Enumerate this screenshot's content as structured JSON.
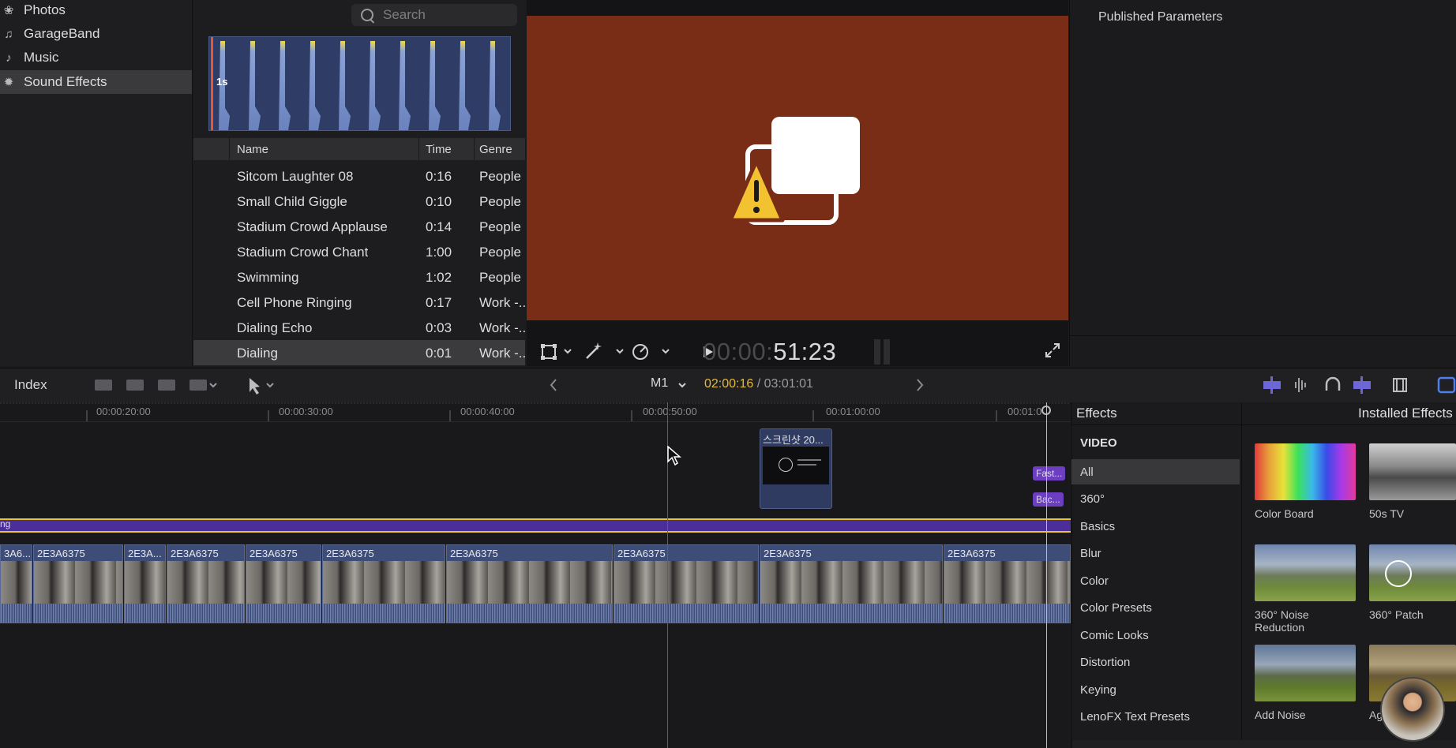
{
  "sidebar": {
    "items": [
      {
        "label": "Photos",
        "icon": "photos-icon"
      },
      {
        "label": "GarageBand",
        "icon": "garageband-icon"
      },
      {
        "label": "Music",
        "icon": "music-icon"
      },
      {
        "label": "Sound Effects",
        "icon": "sound-effects-icon",
        "selected": true
      }
    ]
  },
  "browser": {
    "search_placeholder": "Search",
    "waveform_label": "1s",
    "columns": [
      "Name",
      "Time",
      "Genre"
    ],
    "rows": [
      {
        "name": "Sitcom Laughter 08",
        "time": "0:16",
        "genre": "People"
      },
      {
        "name": "Small Child Giggle",
        "time": "0:10",
        "genre": "People"
      },
      {
        "name": "Stadium Crowd Applause",
        "time": "0:14",
        "genre": "People"
      },
      {
        "name": "Stadium Crowd Chant",
        "time": "1:00",
        "genre": "People"
      },
      {
        "name": "Swimming",
        "time": "1:02",
        "genre": "People"
      },
      {
        "name": "Cell Phone Ringing",
        "time": "0:17",
        "genre": "Work -.."
      },
      {
        "name": "Dialing Echo",
        "time": "0:03",
        "genre": "Work -.."
      },
      {
        "name": "Dialing",
        "time": "0:01",
        "genre": "Work -..",
        "selected": true
      }
    ]
  },
  "viewer": {
    "background_color": "#7a2d16",
    "timecode_dim": "00:00:",
    "timecode_bright": "51:23"
  },
  "inspector": {
    "title": "Published Parameters"
  },
  "timeline_toolbar": {
    "index_label": "Index",
    "project_name": "M1",
    "timecode_current": "02:00:16",
    "timecode_total": "/ 03:01:01"
  },
  "timeline": {
    "ruler": [
      "00:00:20:00",
      "00:00:30:00",
      "00:00:40:00",
      "00:00:50:00",
      "00:01:00:00",
      "00:01:0"
    ],
    "connected_clip_title": "스크린샷 20...",
    "title_tags": [
      "Fast...",
      "Bac..."
    ],
    "storyline_label": "ng",
    "clips": [
      {
        "title": "3A6..."
      },
      {
        "title": "2E3A6375"
      },
      {
        "title": "2E3A..."
      },
      {
        "title": "2E3A6375"
      },
      {
        "title": "2E3A6375"
      },
      {
        "title": "2E3A6375"
      },
      {
        "title": "2E3A6375"
      },
      {
        "title": "2E3A6375"
      },
      {
        "title": "2E3A6375"
      },
      {
        "title": "2E3A6375"
      }
    ]
  },
  "effects": {
    "title": "Effects",
    "installed_title": "Installed Effects",
    "section": "VIDEO",
    "categories": [
      "All",
      "360°",
      "Basics",
      "Blur",
      "Color",
      "Color Presets",
      "Comic Looks",
      "Distortion",
      "Keying",
      "LenoFX Text Presets"
    ],
    "selected_category": "All",
    "items": [
      {
        "label": "Color Board"
      },
      {
        "label": "50s TV"
      },
      {
        "label": "360° Noise Reduction"
      },
      {
        "label": "360° Patch"
      },
      {
        "label": "Add Noise"
      },
      {
        "label": "Aged Film"
      }
    ]
  }
}
